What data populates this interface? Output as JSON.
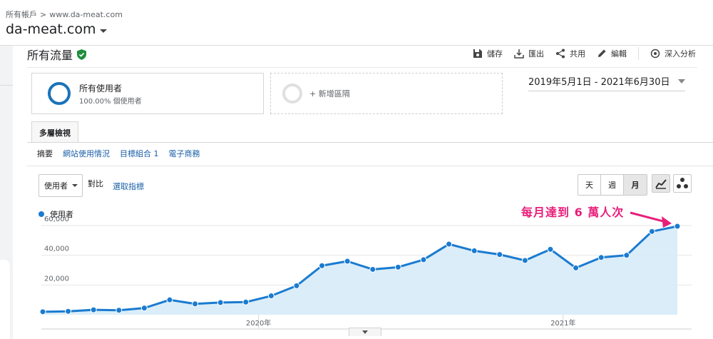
{
  "breadcrumb": {
    "root": "所有帳戶",
    "separator": ">",
    "property": "www.da-meat.com"
  },
  "account": {
    "name": "da-meat.com"
  },
  "report": {
    "title": "所有流量",
    "actions": [
      {
        "label": "儲存",
        "icon": "save-icon"
      },
      {
        "label": "匯出",
        "icon": "export-icon"
      },
      {
        "label": "共用",
        "icon": "share-icon"
      },
      {
        "label": "編輯",
        "icon": "edit-icon"
      },
      {
        "label": "深入分析",
        "icon": "insights-icon"
      }
    ]
  },
  "segments": {
    "primary": {
      "name": "所有使用者",
      "sub": "100.00% 個使用者"
    },
    "add_label": "+ 新增區隔"
  },
  "date_range": "2019年5月1日 - 2021年6月30日",
  "tab": "多層檢視",
  "subtabs": [
    "摘要",
    "網站使用情況",
    "目標組合 1",
    "電子商務"
  ],
  "controls": {
    "metric": "使用者",
    "versus": "對比",
    "pick_metric": "選取指標",
    "periods": [
      "天",
      "週",
      "月"
    ],
    "active_period": "月"
  },
  "colors": {
    "series": "#1a7bd0",
    "fill": "#d6ebf7",
    "annotation": "#e91e7a",
    "link": "#1a5fa8"
  },
  "annotation": "每月達到 6 萬人次",
  "chart_data": {
    "type": "area",
    "series": [
      {
        "name": "使用者",
        "values": [
          2000,
          2300,
          3300,
          3000,
          4500,
          10000,
          7300,
          8200,
          8500,
          12700,
          19500,
          33000,
          36000,
          30500,
          32000,
          37000,
          47500,
          43000,
          40500,
          36500,
          44000,
          31500,
          38500,
          40000,
          56000,
          59500
        ]
      }
    ],
    "x_labels": [
      {
        "index": 8,
        "label": "2020年"
      },
      {
        "index": 20,
        "label": "2021年"
      }
    ],
    "yticks": [
      20000,
      40000,
      60000
    ],
    "ytick_labels": [
      "20,000",
      "40,000",
      "60,000"
    ],
    "ylim": [
      0,
      60000
    ],
    "grid": true,
    "legend": "top-left"
  }
}
